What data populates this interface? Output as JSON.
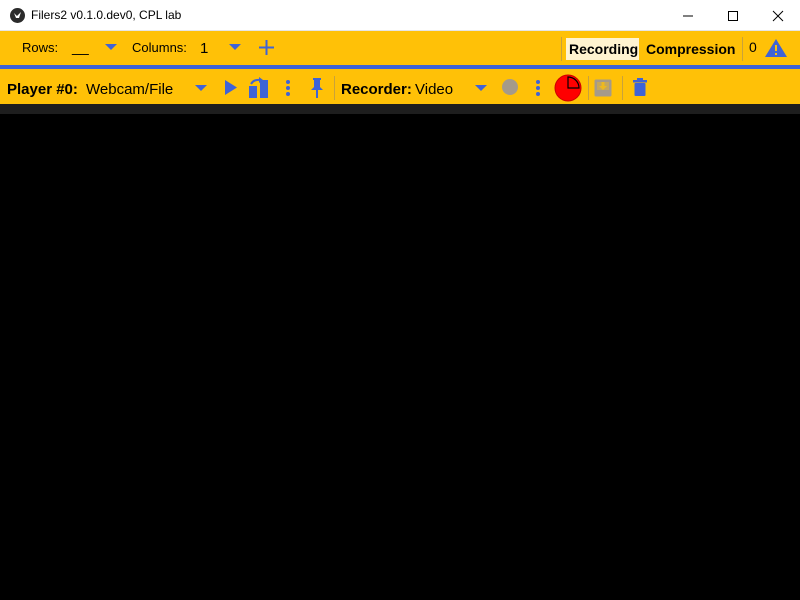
{
  "window": {
    "title": "Filers2 v0.1.0.dev0, CPL lab"
  },
  "toolbar1": {
    "rows_label": "Rows:",
    "rows_value": "__",
    "columns_label": "Columns:",
    "columns_value": "1",
    "recording_tab": "Recording",
    "compression_tab": "Compression",
    "warnings_count": "0"
  },
  "toolbar2": {
    "player_label": "Player #0:",
    "player_source": "Webcam/File",
    "recorder_label": "Recorder:",
    "recorder_type": "Video"
  },
  "colors": {
    "toolbar_bg": "#ffc107",
    "accent": "#3f63d6",
    "record_red": "#ff0000",
    "disabled_gray": "#a59a8a"
  },
  "icons": [
    "app-logo-icon",
    "minimize-icon",
    "maximize-icon",
    "close-icon",
    "dropdown-arrow-icon",
    "plus-icon",
    "warning-icon",
    "play-icon",
    "refresh-config-icon",
    "more-vert-icon",
    "pin-icon",
    "record-dot-icon",
    "disk-usage-pie-icon",
    "save-to-disk-icon",
    "delete-icon"
  ]
}
